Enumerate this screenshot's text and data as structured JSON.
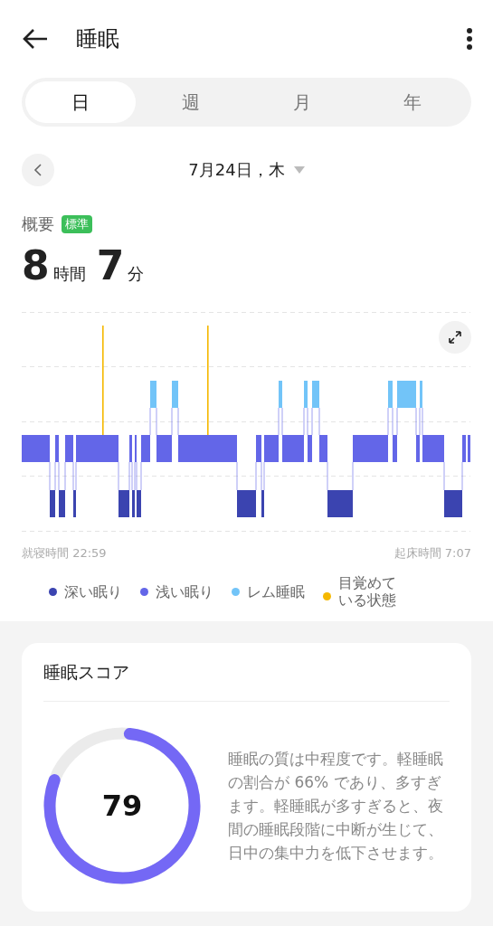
{
  "header": {
    "title": "睡眠"
  },
  "tabs": [
    {
      "label": "日",
      "selected": true
    },
    {
      "label": "週",
      "selected": false
    },
    {
      "label": "月",
      "selected": false
    },
    {
      "label": "年",
      "selected": false
    }
  ],
  "date": {
    "label": "7月24日，木"
  },
  "overview": {
    "label": "概要",
    "badge": "標準",
    "hours": "8",
    "hours_unit": "時間",
    "minutes": "7",
    "minutes_unit": "分"
  },
  "hypnogram": {
    "start_label": "就寝時間 22:59",
    "end_label": "起床時間 7:07"
  },
  "legend": [
    {
      "label": "深い眠り",
      "color": "#3b44b0"
    },
    {
      "label": "浅い眠り",
      "color": "#6366e8"
    },
    {
      "label": "レム睡眠",
      "color": "#72c4f8"
    },
    {
      "label": "目覚めている状態",
      "color": "#f5b800"
    }
  ],
  "score_card": {
    "title": "睡眠スコア",
    "score": "79",
    "level": 0.79,
    "description": "睡眠の質は中程度です。軽睡眠の割合が 66% であり、多すぎます。軽睡眠が多すぎると、夜間の睡眠段階に中断が生じて、日中の集中力を低下させます。"
  }
}
